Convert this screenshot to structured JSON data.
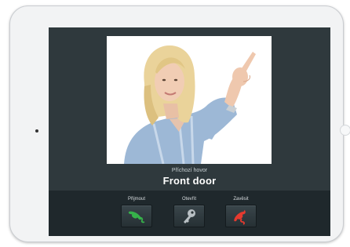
{
  "call": {
    "status": "Příchozí hovor",
    "caller": "Front door"
  },
  "actions": [
    {
      "label": "Přijmout",
      "icon": "phone-answer-icon",
      "color": "#36b24a"
    },
    {
      "label": "Otevřít",
      "icon": "key-icon",
      "color": "#b9c0c4"
    },
    {
      "label": "Zavěsit",
      "icon": "phone-hangup-icon",
      "color": "#e53a2f"
    }
  ]
}
